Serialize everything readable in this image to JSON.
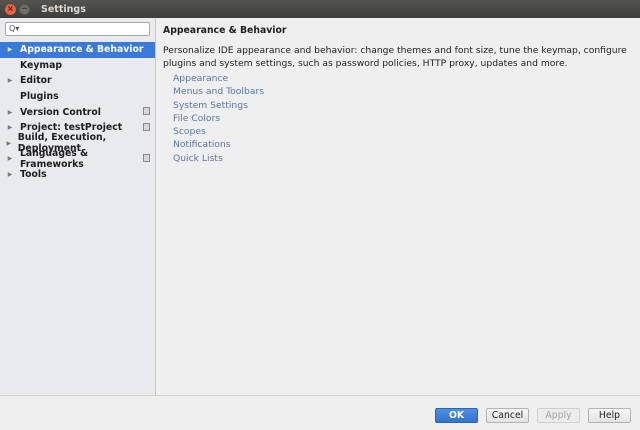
{
  "window": {
    "title": "Settings",
    "close_glyph": "×",
    "minimize_glyph": "−"
  },
  "search": {
    "value": "",
    "placeholder": "",
    "icon": "Q▾"
  },
  "tree": [
    {
      "label": "Appearance & Behavior",
      "arrow": "▶",
      "selected": true
    },
    {
      "label": "Keymap",
      "arrow": ""
    },
    {
      "label": "Editor",
      "arrow": "▶"
    },
    {
      "label": "Plugins",
      "arrow": ""
    },
    {
      "label": "Version Control",
      "arrow": "▶"
    },
    {
      "label": "Project: testProject",
      "arrow": "▶"
    },
    {
      "label": "Build, Execution, Deployment",
      "arrow": "▶"
    },
    {
      "label": "Languages & Frameworks",
      "arrow": "▶"
    },
    {
      "label": "Tools",
      "arrow": "▶"
    }
  ],
  "content": {
    "heading": "Appearance & Behavior",
    "description": "Personalize IDE appearance and behavior: change themes and font size, tune the keymap, configure plugins and system settings, such as password policies, HTTP proxy, updates and more.",
    "links": [
      "Appearance",
      "Menus and Toolbars",
      "System Settings",
      "File Colors",
      "Scopes",
      "Notifications",
      "Quick Lists"
    ]
  },
  "buttons": {
    "ok": "OK",
    "cancel": "Cancel",
    "apply": "Apply",
    "help": "Help"
  },
  "colors": {
    "selection": "#3a7ad9",
    "link": "#5876ae",
    "ok_button": "#3573d0"
  }
}
